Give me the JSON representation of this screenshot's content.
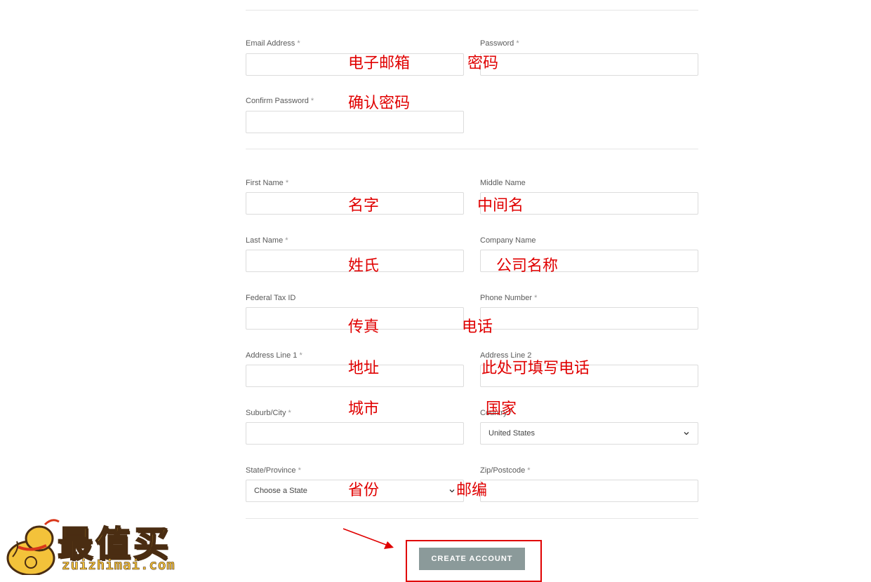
{
  "form": {
    "required_mark": "*",
    "fields": {
      "email": {
        "label": "Email Address",
        "value": ""
      },
      "password": {
        "label": "Password",
        "value": ""
      },
      "confirm_password": {
        "label": "Confirm Password",
        "value": ""
      },
      "first_name": {
        "label": "First Name",
        "value": ""
      },
      "middle_name": {
        "label": "Middle Name",
        "value": ""
      },
      "last_name": {
        "label": "Last Name",
        "value": ""
      },
      "company_name": {
        "label": "Company Name",
        "value": ""
      },
      "federal_tax_id": {
        "label": "Federal Tax ID",
        "value": ""
      },
      "phone_number": {
        "label": "Phone Number",
        "value": ""
      },
      "address_line_1": {
        "label": "Address Line 1",
        "value": ""
      },
      "address_line_2": {
        "label": "Address Line 2",
        "value": ""
      },
      "city": {
        "label": "Suburb/City",
        "value": ""
      },
      "country": {
        "label": "Country",
        "selected": "United States"
      },
      "state": {
        "label": "State/Province",
        "selected": "Choose a State"
      },
      "zip": {
        "label": "Zip/Postcode",
        "value": ""
      }
    },
    "submit_label": "CREATE ACCOUNT"
  },
  "annotations": {
    "email": "电子邮箱",
    "password": "密码",
    "confirm_password": "确认密码",
    "first_name": "名字",
    "middle_name": "中间名",
    "last_name": "姓氏",
    "company_name": "公司名称",
    "fax": "传真",
    "phone": "电话",
    "address": "地址",
    "address_line_2": "此处可填写电话",
    "city": "城市",
    "country": "国家",
    "state": "省份",
    "zip": "邮编"
  },
  "watermark": {
    "title": "最值买",
    "url": "zuizhimai.com",
    "color": "#f3c23a"
  },
  "colors": {
    "annotation": "#e00000",
    "button": "#8b9a9a"
  }
}
